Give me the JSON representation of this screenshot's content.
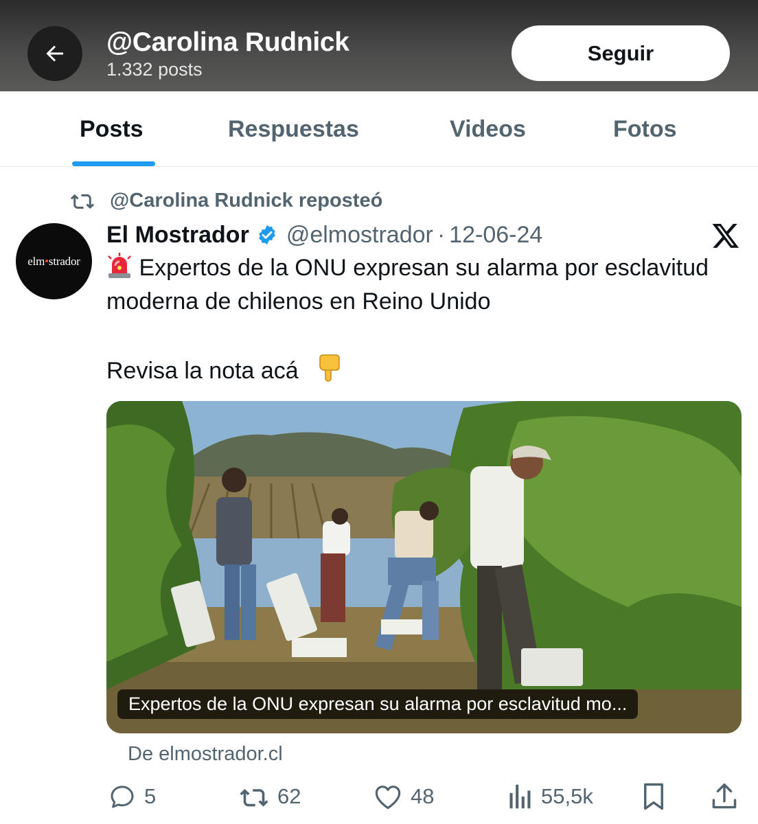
{
  "header": {
    "title": "@Carolina Rudnick",
    "subtitle": "1.332 posts",
    "follow_label": "Seguir"
  },
  "tabs": [
    {
      "label": "Posts",
      "active": true
    },
    {
      "label": "Respuestas",
      "active": false
    },
    {
      "label": "Videos",
      "active": false
    },
    {
      "label": "Fotos",
      "active": false
    }
  ],
  "repost": {
    "text": "@Carolina Rudnick reposteó"
  },
  "tweet": {
    "avatar_text": {
      "left": "elm",
      "dot": "•",
      "right": "strador"
    },
    "author_name": "El Mostrador",
    "handle": "@elmostrador",
    "separator": "·",
    "date": "12-06-24",
    "text_line1": "Expertos de la ONU expresan su alarma por esclavitud moderna de chilenos en Reino Unido",
    "text_line2": "Revisa la nota acá",
    "card": {
      "caption": "Expertos de la ONU expresan su alarma por esclavitud mo...",
      "source": "De elmostrador.cl"
    },
    "stats": {
      "replies": "5",
      "reposts": "62",
      "likes": "48",
      "views": "55,5k"
    }
  },
  "colors": {
    "accent": "#1d9bf0",
    "secondary_text": "#536471",
    "primary_text": "#0f1419"
  },
  "icons": [
    "back-arrow-icon",
    "repost-icon",
    "verified-badge-icon",
    "x-logo-icon",
    "siren-emoji-icon",
    "pointing-down-emoji-icon",
    "reply-icon",
    "retweet-icon",
    "like-icon",
    "views-icon",
    "bookmark-icon",
    "share-icon"
  ]
}
